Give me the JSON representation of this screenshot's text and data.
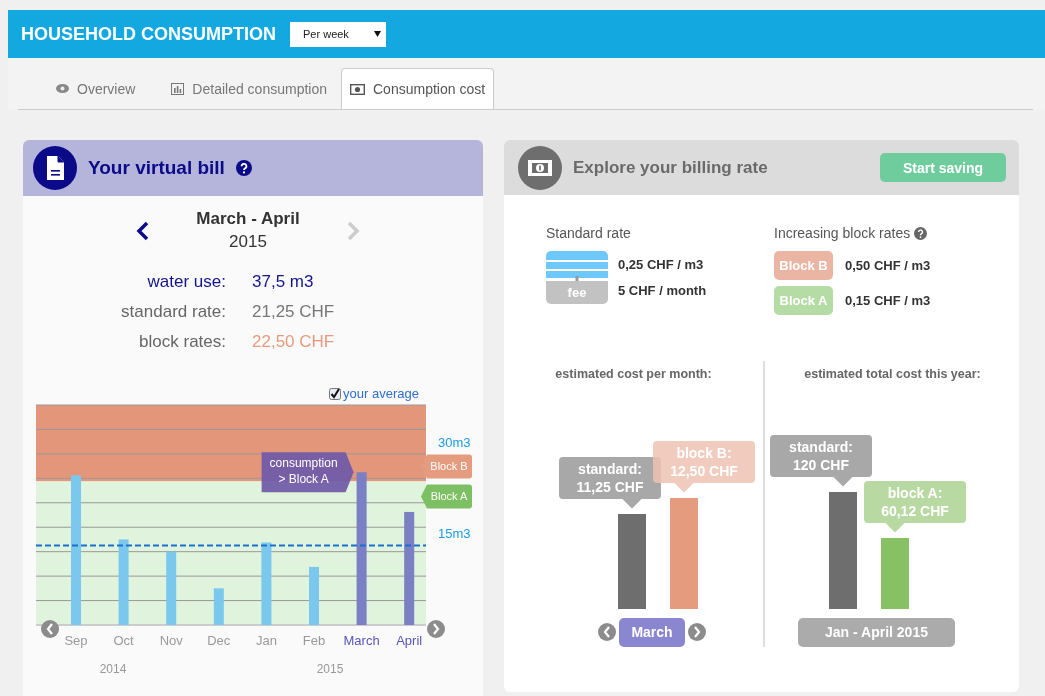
{
  "header": {
    "title": "HOUSEHOLD CONSUMPTION",
    "period_select": {
      "value": "Per week"
    }
  },
  "tabs": [
    {
      "label": "Overview",
      "selected": false
    },
    {
      "label": "Detailed consumption",
      "selected": false
    },
    {
      "label": "Consumption cost",
      "selected": true
    }
  ],
  "virtual_bill": {
    "title": "Your virtual bill",
    "period": {
      "months": "March - April",
      "year": "2015",
      "prev": {
        "disabled": false
      },
      "next": {
        "disabled": true
      }
    },
    "stats": [
      {
        "kind": "usage",
        "label": "water use:",
        "value": "37,5 m3"
      },
      {
        "kind": "standard",
        "label": "standard rate:",
        "value": "21,25 CHF"
      },
      {
        "kind": "block",
        "label": "block rates:",
        "value": "22,50 CHF"
      }
    ],
    "average_toggle": {
      "label": "your average",
      "checked": true
    },
    "months": [
      {
        "label": "Sep",
        "selected": false
      },
      {
        "label": "Oct",
        "selected": false
      },
      {
        "label": "Nov",
        "selected": false
      },
      {
        "label": "Dec",
        "selected": false
      },
      {
        "label": "Jan",
        "selected": false
      },
      {
        "label": "Feb",
        "selected": false
      },
      {
        "label": "March",
        "selected": true
      },
      {
        "label": "April",
        "selected": true
      }
    ],
    "scale_labels": [
      "30m3",
      "15m3"
    ],
    "block_tags": [
      {
        "label": "Block B",
        "color": "#e59b7e"
      },
      {
        "label": "Block A",
        "color": "#7cc063"
      }
    ],
    "callout": [
      "consumption",
      "> Block A"
    ],
    "years": [
      "2014",
      "2015"
    ]
  },
  "billing_rate": {
    "title": "Explore your billing rate",
    "action": "Start saving",
    "standard": {
      "heading": "Standard rate",
      "fee_label": "fee",
      "rates": [
        "0,25 CHF / m3",
        "5 CHF / month"
      ]
    },
    "blocks": {
      "heading": "Increasing block rates",
      "items": [
        {
          "name": "Block B",
          "rate": "0,50 CHF / m3",
          "color": "#ebb5a3"
        },
        {
          "name": "Block A",
          "rate": "0,15 CHF / m3",
          "color": "#b6dca5"
        }
      ]
    },
    "monthly": {
      "heading": "estimated cost per month:",
      "period": "March",
      "bars": [
        {
          "label": "standard:",
          "value": "11,25 CHF",
          "color": "#6e6e6e"
        },
        {
          "label": "block B:",
          "value": "12,50 CHF",
          "color": "#e59b7e"
        }
      ]
    },
    "yearly": {
      "heading": "estimated total cost this year:",
      "period": "Jan - April 2015",
      "bars": [
        {
          "label": "standard:",
          "value": "120 CHF",
          "color": "#6e6e6e"
        },
        {
          "label": "block A:",
          "value": "60,12 CHF",
          "color": "#88c064"
        }
      ]
    }
  }
}
